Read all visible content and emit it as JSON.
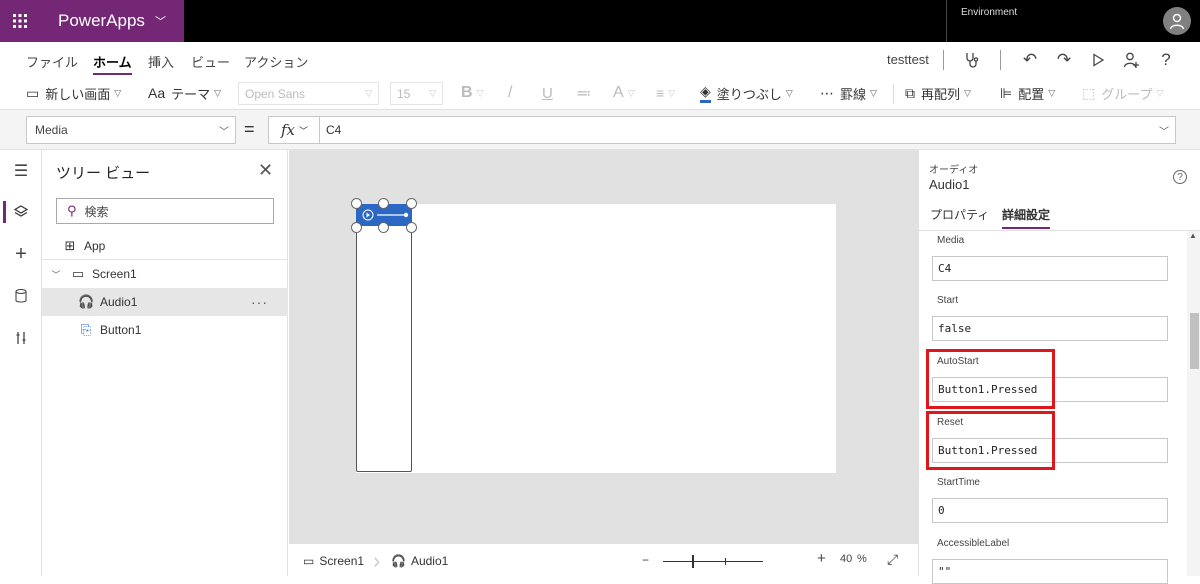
{
  "app": {
    "name": "PowerApps",
    "environment_label": "Environment"
  },
  "menu": {
    "tabs": [
      "ファイル",
      "ホーム",
      "挿入",
      "ビュー",
      "アクション"
    ],
    "active_tab": "ホーム",
    "user": "testtest"
  },
  "ribbon": {
    "new_screen": "新しい画面",
    "theme": "テーマ",
    "font": "Open Sans",
    "font_size": "15",
    "fill": "塗りつぶし",
    "border": "罫線",
    "reorder": "再配列",
    "align": "配置",
    "group": "グループ"
  },
  "formula_bar": {
    "property": "Media",
    "equals": "=",
    "fx": "fx",
    "formula": "C4"
  },
  "tree_view": {
    "title": "ツリー ビュー",
    "search_placeholder": "検索",
    "items": [
      {
        "label": "App",
        "icon": "app-icon"
      },
      {
        "label": "Screen1",
        "icon": "screen-icon"
      },
      {
        "label": "Audio1",
        "icon": "headphones-icon",
        "selected": true
      },
      {
        "label": "Button1",
        "icon": "button-icon"
      }
    ],
    "more": "···"
  },
  "status_bar": {
    "screen": "Screen1",
    "control": "Audio1",
    "zoom_minus": "−",
    "zoom_plus": "+",
    "zoom": "40",
    "zoom_unit": "%",
    "zoom_percent": 40
  },
  "properties_panel": {
    "control_type": "オーディオ",
    "control_name": "Audio1",
    "help": "?",
    "tabs": [
      "プロパティ",
      "詳細設定"
    ],
    "active_tab": "詳細設定",
    "fields": [
      {
        "label": "Media",
        "value": "C4"
      },
      {
        "label": "Start",
        "value": "false"
      },
      {
        "label": "AutoStart",
        "value": "Button1.Pressed",
        "highlighted": true
      },
      {
        "label": "Reset",
        "value": "Button1.Pressed",
        "highlighted": true
      },
      {
        "label": "StartTime",
        "value": "0"
      },
      {
        "label": "AccessibleLabel",
        "value": "\"\""
      }
    ]
  },
  "colors": {
    "brand": "#742774",
    "highlight": "#e0161d",
    "audio_control": "#2b68c3"
  }
}
